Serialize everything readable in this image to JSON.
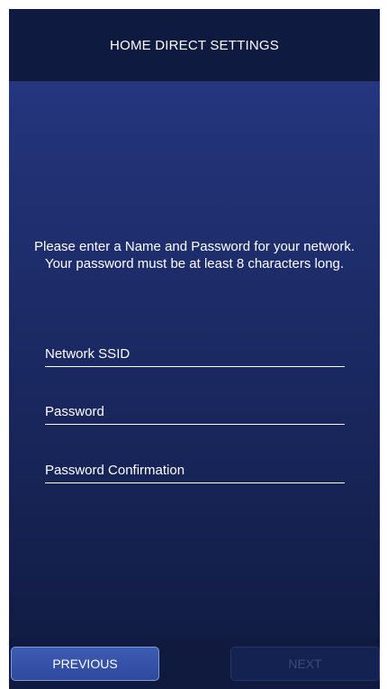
{
  "header": {
    "title": "HOME DIRECT SETTINGS"
  },
  "instructions": {
    "text": "Please enter a Name and Password for your network. Your password must be at least 8 characters long."
  },
  "form": {
    "ssid": {
      "placeholder": "Network SSID",
      "value": ""
    },
    "password": {
      "placeholder": "Password",
      "value": ""
    },
    "password_confirmation": {
      "placeholder": "Password Confirmation",
      "value": ""
    }
  },
  "footer": {
    "previous_label": "PREVIOUS",
    "next_label": "NEXT"
  },
  "colors": {
    "header_bg": "#0e1a40",
    "body_gradient_top": "#2a3b8a",
    "body_gradient_bottom": "#0f1a3e",
    "primary_button": "#2e4a9e",
    "disabled_button_text": "#3a4a7e"
  }
}
